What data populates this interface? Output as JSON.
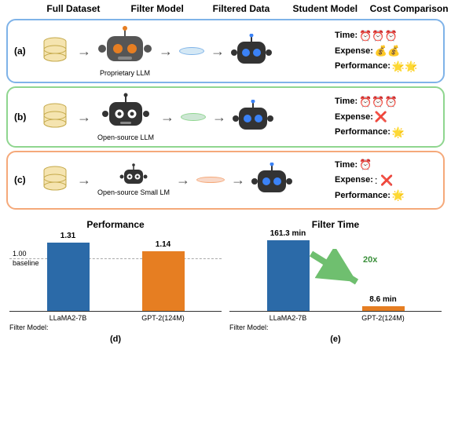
{
  "headers": {
    "col1": "Full Dataset",
    "col2": "Filter Model",
    "col3": "Filtered Data",
    "col4": "Student Model",
    "col5": "Cost Comparison"
  },
  "rows": {
    "a": {
      "label": "(a)",
      "filter_name": "Proprietary LLM"
    },
    "b": {
      "label": "(b)",
      "filter_name": "Open-source LLM"
    },
    "c": {
      "label": "(c)",
      "filter_name": "Open-source Small LM"
    }
  },
  "cost_labels": {
    "time": "Time:",
    "expense": "Expense:",
    "performance": "Performance:"
  },
  "cost_icons": {
    "a": {
      "time": "⏰⏰⏰",
      "expense": "💰💰",
      "performance": "🌟🌟"
    },
    "b": {
      "time": "⏰⏰⏰",
      "expense": "❌",
      "performance": "🌟"
    },
    "c": {
      "time": "⏰",
      "expense": ": ❌",
      "performance": "🌟"
    }
  },
  "charts": {
    "d": {
      "title": "Performance",
      "baseline_label_1": "1.00",
      "baseline_label_2": "baseline",
      "sublabel": "(d)",
      "axis_label": "Filter Model:"
    },
    "e": {
      "title": "Filter Time",
      "speedup": "20x",
      "sublabel": "(e)",
      "axis_label": "Filter Model:"
    },
    "models": {
      "m1": "LLaMA2-7B",
      "m2": "GPT-2(124M)"
    }
  },
  "chart_data": [
    {
      "type": "bar",
      "title": "Performance",
      "categories": [
        "LLaMA2-7B",
        "GPT-2(124M)"
      ],
      "values": [
        1.31,
        1.14
      ],
      "baseline": 1.0,
      "ylim": [
        0,
        1.5
      ],
      "xlabel": "Filter Model",
      "ylabel": ""
    },
    {
      "type": "bar",
      "title": "Filter Time",
      "categories": [
        "LLaMA2-7B",
        "GPT-2(124M)"
      ],
      "values": [
        161.3,
        8.6
      ],
      "units": "min",
      "speedup": "20x",
      "ylim": [
        0,
        180
      ],
      "xlabel": "Filter Model",
      "ylabel": ""
    }
  ],
  "bar_labels": {
    "d1": "1.31",
    "d2": "1.14",
    "e1": "161.3 min",
    "e2": "8.6 min"
  }
}
